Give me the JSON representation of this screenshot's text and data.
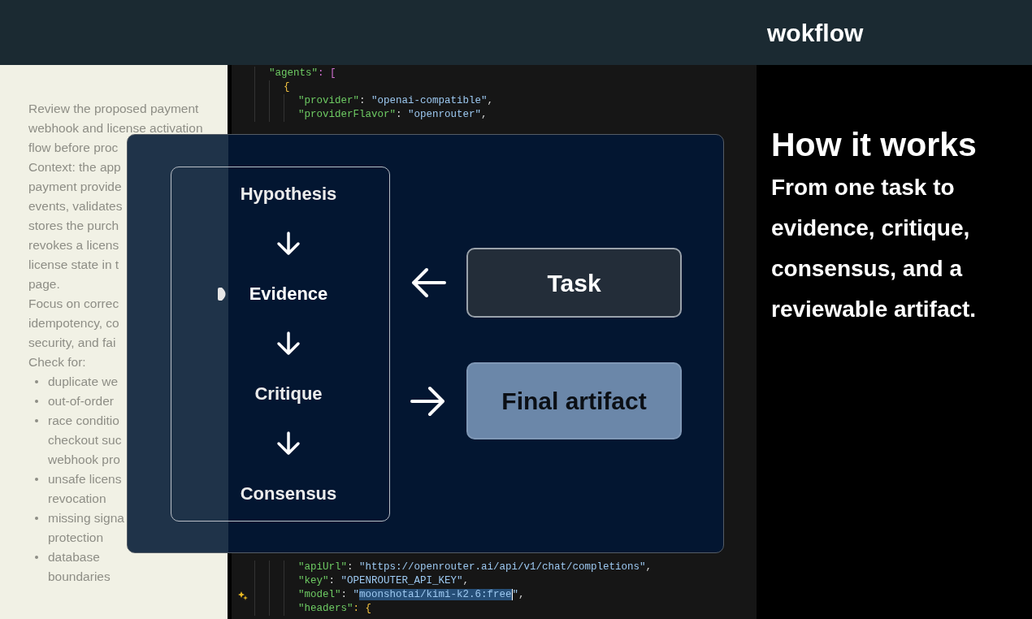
{
  "header": {
    "brand": "wokflow"
  },
  "document_panel": {
    "lines": [
      {
        "text": "Review the proposed payment",
        "kind": "text"
      },
      {
        "text": "webhook and license activation",
        "kind": "text"
      },
      {
        "text": "flow before proc",
        "kind": "text"
      },
      {
        "text": "Context: the app",
        "kind": "text"
      },
      {
        "text": "payment provide",
        "kind": "text"
      },
      {
        "text": "events, validates",
        "kind": "text"
      },
      {
        "text": "stores the purch",
        "kind": "text"
      },
      {
        "text": "revokes a licens",
        "kind": "text"
      },
      {
        "text": "license state in t",
        "kind": "text"
      },
      {
        "text": "page.",
        "kind": "text"
      },
      {
        "text": "Focus on correc",
        "kind": "text"
      },
      {
        "text": "idempotency, co",
        "kind": "text"
      },
      {
        "text": "security, and fai",
        "kind": "text"
      },
      {
        "text": "Check for:",
        "kind": "text"
      },
      {
        "text": "duplicate we",
        "kind": "bullet"
      },
      {
        "text": "out-of-order",
        "kind": "bullet"
      },
      {
        "text": "race conditio",
        "kind": "bullet"
      },
      {
        "text": "checkout suc",
        "kind": "continuation"
      },
      {
        "text": "webhook pro",
        "kind": "continuation"
      },
      {
        "text": "unsafe licens",
        "kind": "bullet"
      },
      {
        "text": "revocation",
        "kind": "continuation"
      },
      {
        "text": "missing signa",
        "kind": "bullet"
      },
      {
        "text": "protection",
        "kind": "continuation"
      },
      {
        "text": "database",
        "kind": "bullet"
      },
      {
        "text": "boundaries",
        "kind": "continuation"
      }
    ]
  },
  "editor": {
    "top_lines": [
      {
        "text": "\"agents\": [",
        "children": [
          {
            "text": "{",
            "children": [
              {
                "text": "\"provider\": \"openai-compatible\","
              },
              {
                "text": "\"providerFlavor\": \"openrouter\","
              }
            ]
          }
        ]
      }
    ],
    "bottom_lines": [
      {
        "text": "\"apiUrl\": \"https://openrouter.ai/api/v1/chat/completions\",",
        "hint": false,
        "selected_value": false
      },
      {
        "text": "\"key\": \"OPENROUTER_API_KEY\",",
        "hint": false,
        "selected_value": false
      },
      {
        "text": "\"model\": \"moonshotai/kimi-k2.6:free\",",
        "hint": true,
        "selected_value": true
      },
      {
        "text": "\"headers\": {",
        "hint": false,
        "selected_value": false
      }
    ]
  },
  "diagram": {
    "steps": [
      {
        "label": "Hypothesis",
        "selected": false
      },
      {
        "label": "Evidence",
        "selected": true
      },
      {
        "label": "Critique",
        "selected": false
      },
      {
        "label": "Consensus",
        "selected": false
      }
    ],
    "task": {
      "label": "Task"
    },
    "artifact": {
      "label": "Final artifact"
    }
  },
  "explainer": {
    "title": "How it works",
    "body": "From one task to evidence, critique, consensus, and a reviewable artifact."
  }
}
